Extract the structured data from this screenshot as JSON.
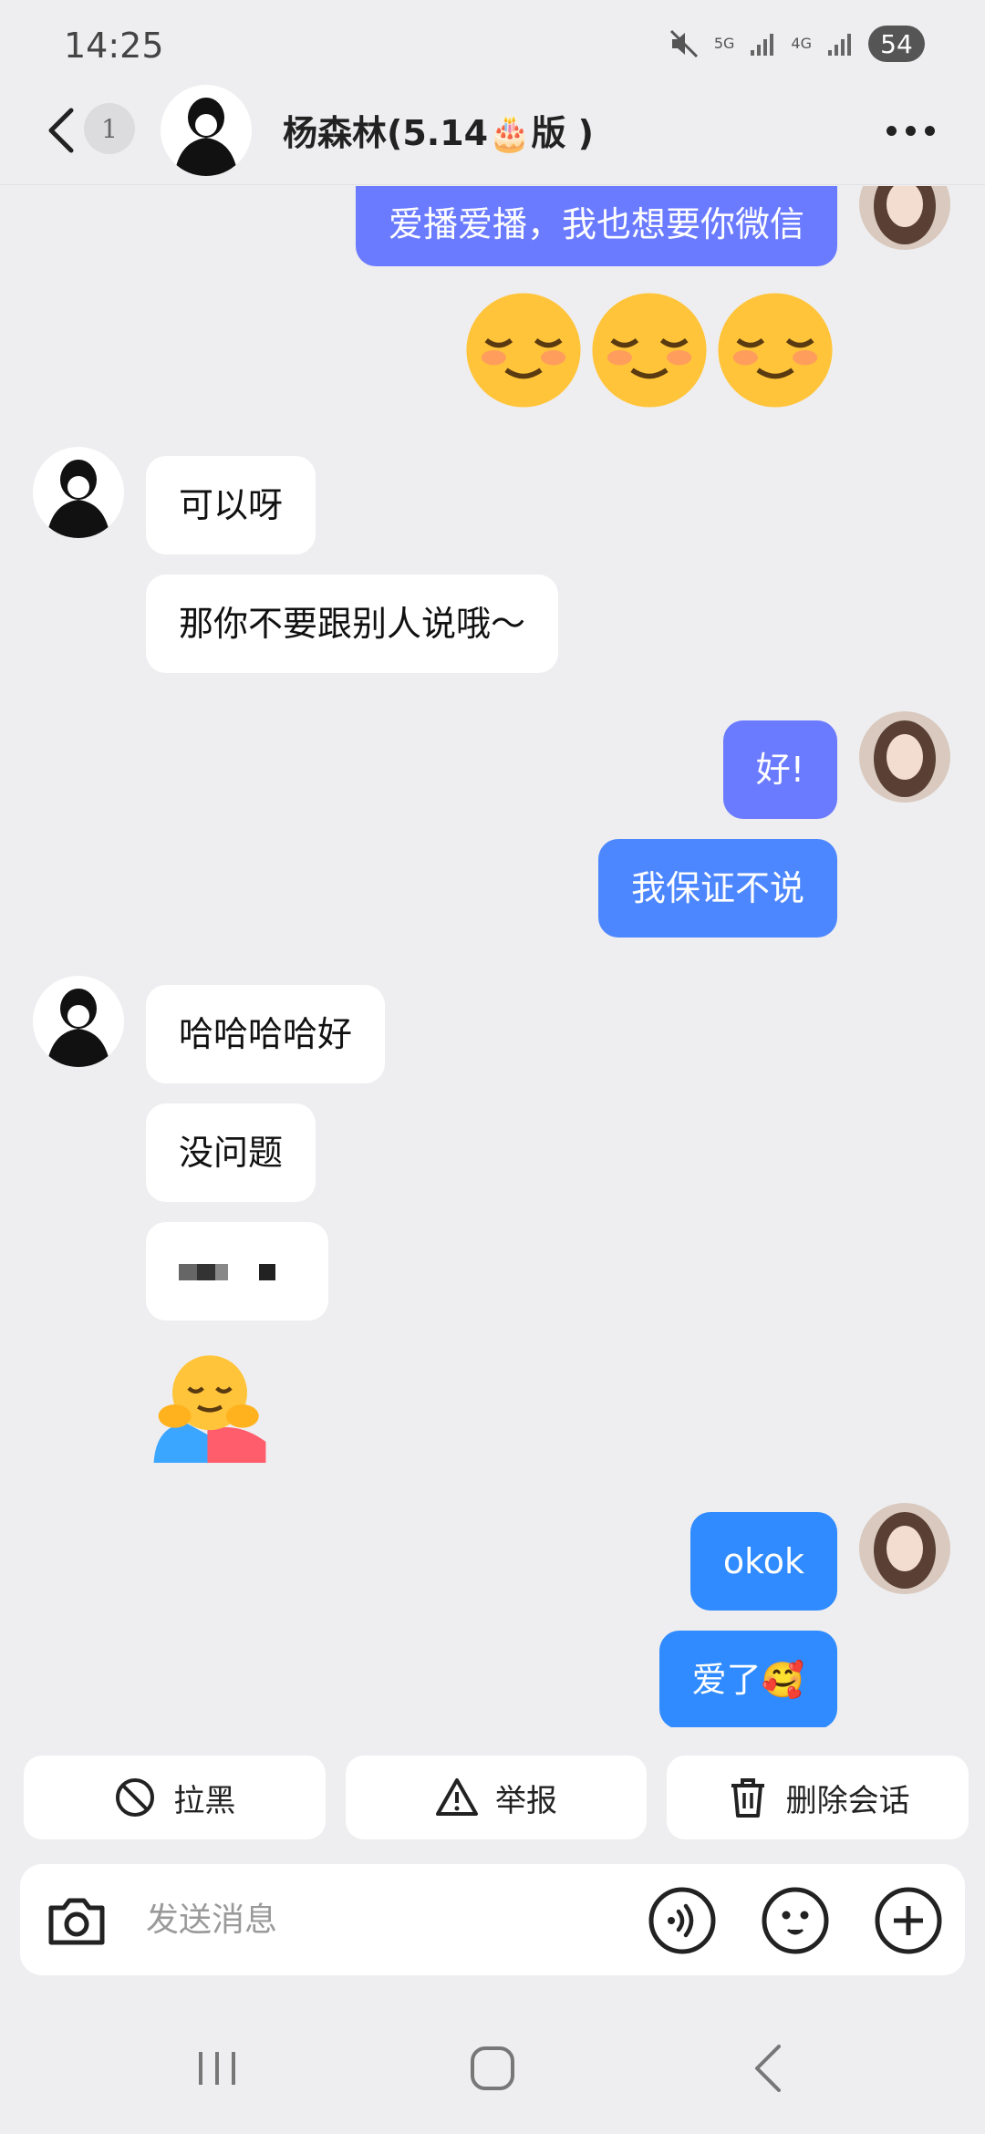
{
  "status_bar": {
    "time": "14:25",
    "network_1": "5G",
    "network_2": "4G",
    "battery": "54"
  },
  "header": {
    "unread_count": "1",
    "title": "杨森林(5.14🎂版 )"
  },
  "messages": [
    {
      "side": "out",
      "text": "爱播爱播，我也想要你微信"
    },
    {
      "side": "out",
      "emoji": "😌😌😌"
    },
    {
      "side": "in",
      "text": "可以呀"
    },
    {
      "side": "in",
      "text": "那你不要跟别人说哦～"
    },
    {
      "side": "out",
      "text": "好!"
    },
    {
      "side": "out",
      "text": "我保证不说"
    },
    {
      "side": "in",
      "text": "哈哈哈哈好"
    },
    {
      "side": "in",
      "text": "没问题"
    },
    {
      "side": "in",
      "text": "censored"
    },
    {
      "side": "in",
      "emoji": "🫂"
    },
    {
      "side": "out",
      "text": "okok"
    },
    {
      "side": "out",
      "text": "爱了🥰"
    }
  ],
  "actions": {
    "block": "拉黑",
    "report": "举报",
    "delete": "删除会话"
  },
  "composer": {
    "placeholder": "发送消息"
  },
  "icons": {
    "back": "chevron-left-icon",
    "more": "more-icon",
    "camera": "camera-icon",
    "voice": "voice-icon",
    "emoji": "emoji-icon",
    "add": "plus-icon"
  },
  "colors": {
    "bubble_out_1": "#6b7bff",
    "bubble_out_2": "#4d87ff",
    "bubble_out_3": "#2f8bff",
    "background": "#eeeef0"
  }
}
